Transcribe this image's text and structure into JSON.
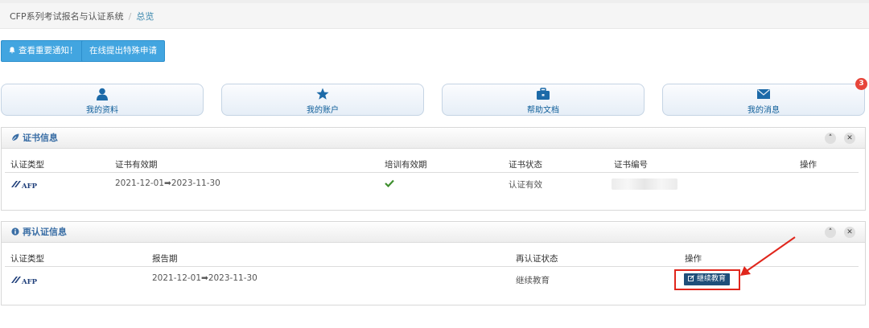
{
  "breadcrumb": {
    "root": "CFP系列考试报名与认证系统",
    "separator": "/",
    "current": "总览"
  },
  "actions": {
    "notice_label": "查看重要通知！",
    "apply_label": "在线提出特殊申请"
  },
  "shortcuts": [
    {
      "label": "我的资料",
      "icon": "user-icon"
    },
    {
      "label": "我的账户",
      "icon": "star-icon"
    },
    {
      "label": "帮助文档",
      "icon": "briefcase-icon"
    },
    {
      "label": "我的消息",
      "icon": "envelope-icon",
      "badge": "3"
    }
  ],
  "cert_panel": {
    "title": "证书信息",
    "columns": [
      "认证类型",
      "证书有效期",
      "培训有效期",
      "证书状态",
      "证书编号",
      "操作"
    ],
    "rows": [
      {
        "type_logo": "AFP",
        "validity": "2021-12-01➡2023-11-30",
        "training_valid": "check-icon",
        "status": "认证有效",
        "number": "",
        "action": ""
      }
    ]
  },
  "recert_panel": {
    "title": "再认证信息",
    "columns": [
      "认证类型",
      "报告期",
      "再认证状态",
      "操作"
    ],
    "rows": [
      {
        "type_logo": "AFP",
        "period": "2021-12-01➡2023-11-30",
        "status": "继续教育",
        "action_label": "继续教育"
      }
    ]
  },
  "colors": {
    "accent": "#42a5e0",
    "panel_title": "#3a6ea5",
    "badge": "#e7453a",
    "action_button": "#1f4e79",
    "highlight": "#e0261c"
  }
}
